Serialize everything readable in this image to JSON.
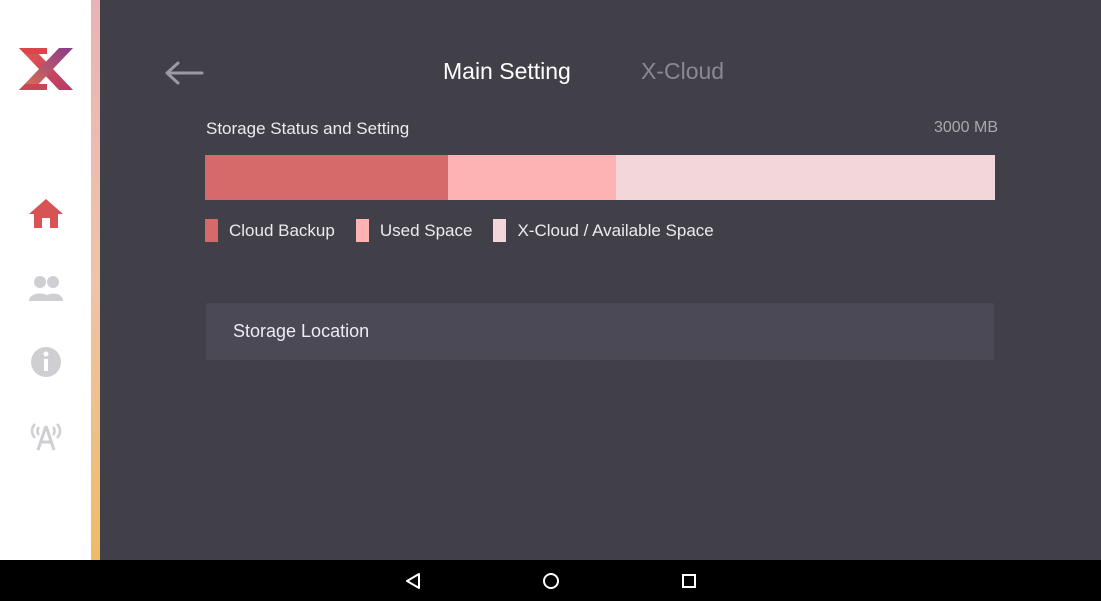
{
  "header": {
    "tabs": [
      {
        "label": "Main Setting",
        "active": true
      },
      {
        "label": "X-Cloud",
        "active": false
      }
    ]
  },
  "sidebar": {
    "logo": "x-logo",
    "items": [
      {
        "icon": "home-icon",
        "active": true
      },
      {
        "icon": "users-icon",
        "active": false
      },
      {
        "icon": "info-icon",
        "active": false
      },
      {
        "icon": "antenna-icon",
        "active": false
      }
    ]
  },
  "storage": {
    "title": "Storage Status and Setting",
    "total": "3000 MB",
    "bar": {
      "cloud_backup_fraction": 0.307,
      "used_space_fraction": 0.213,
      "available_fraction": 0.48
    },
    "legend": [
      {
        "label": "Cloud Backup",
        "color": "#d66a6a"
      },
      {
        "label": "Used Space",
        "color": "#fdb3b4"
      },
      {
        "label": "X-Cloud / Available Space",
        "color": "#f2d6da"
      }
    ]
  },
  "location": {
    "label": "Storage Location"
  },
  "system_nav": [
    "back-icon",
    "home-circle-icon",
    "recents-icon"
  ]
}
